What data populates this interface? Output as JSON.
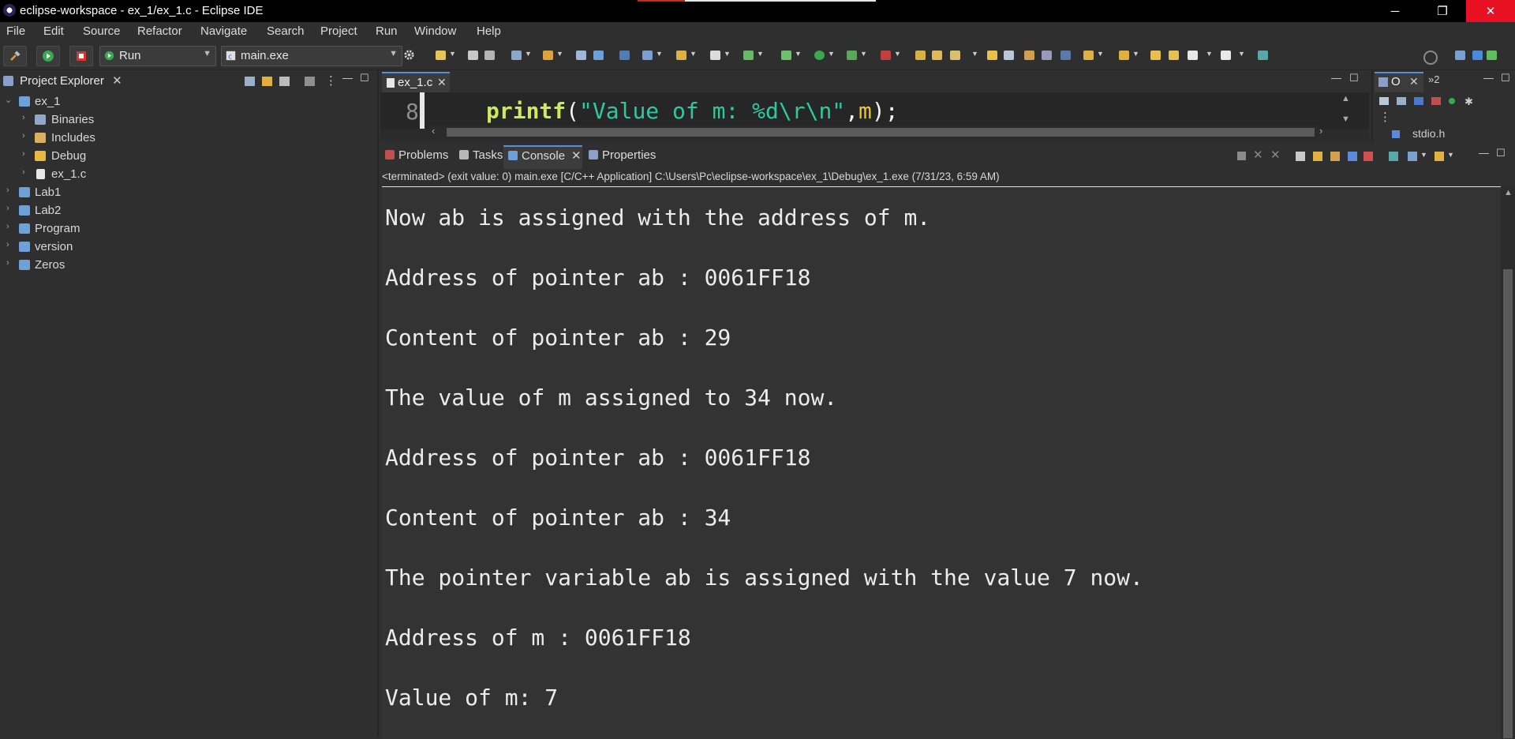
{
  "window": {
    "title": "eclipse-workspace - ex_1/ex_1.c - Eclipse IDE",
    "min_glyph": "─",
    "max_glyph": "❐",
    "close_glyph": "✕"
  },
  "menu": [
    "File",
    "Edit",
    "Source",
    "Refactor",
    "Navigate",
    "Search",
    "Project",
    "Run",
    "Window",
    "Help"
  ],
  "toolbar": {
    "launch_mode": "Run",
    "launch_config": "main.exe"
  },
  "project_explorer": {
    "tab_label": "Project Explorer",
    "items": [
      {
        "label": "ex_1",
        "expanded": true
      },
      {
        "label": "Binaries"
      },
      {
        "label": "Includes"
      },
      {
        "label": "Debug"
      },
      {
        "label": "ex_1.c"
      },
      {
        "label": "Lab1"
      },
      {
        "label": "Lab2"
      },
      {
        "label": "Program"
      },
      {
        "label": "version"
      },
      {
        "label": "Zeros"
      }
    ]
  },
  "editor": {
    "tab_label": "ex_1.c",
    "line_number": "8",
    "code": {
      "fn": "printf",
      "open": "(",
      "str": "\"Value of m: %d\\r\\n\"",
      "comma": ",",
      "var": "m",
      "close": ");"
    }
  },
  "outline": {
    "tab_label": "O",
    "tab2_label": "»2",
    "item": "stdio.h"
  },
  "console_view": {
    "tabs": [
      "Problems",
      "Tasks",
      "Console",
      "Properties"
    ],
    "status": "<terminated> (exit value: 0) main.exe [C/C++ Application] C:\\Users\\Pc\\eclipse-workspace\\ex_1\\Debug\\ex_1.exe (7/31/23, 6:59 AM)",
    "lines": [
      "Now ab is assigned with the address of m.",
      "Address of pointer ab : 0061FF18",
      "Content of pointer ab : 29",
      "The value of m assigned to 34 now.",
      "Address of pointer ab : 0061FF18",
      "Content of pointer ab : 34",
      "The pointer variable ab is assigned with the value 7 now.",
      "Address of m : 0061FF18",
      "Value of m: 7"
    ]
  },
  "colors": {
    "background": "#2f2f2f",
    "console_bg": "#333333",
    "close_button": "#e81123",
    "code_function": "#cdea5a",
    "code_string": "#2fc9a0",
    "code_variable": "#f1c232"
  }
}
